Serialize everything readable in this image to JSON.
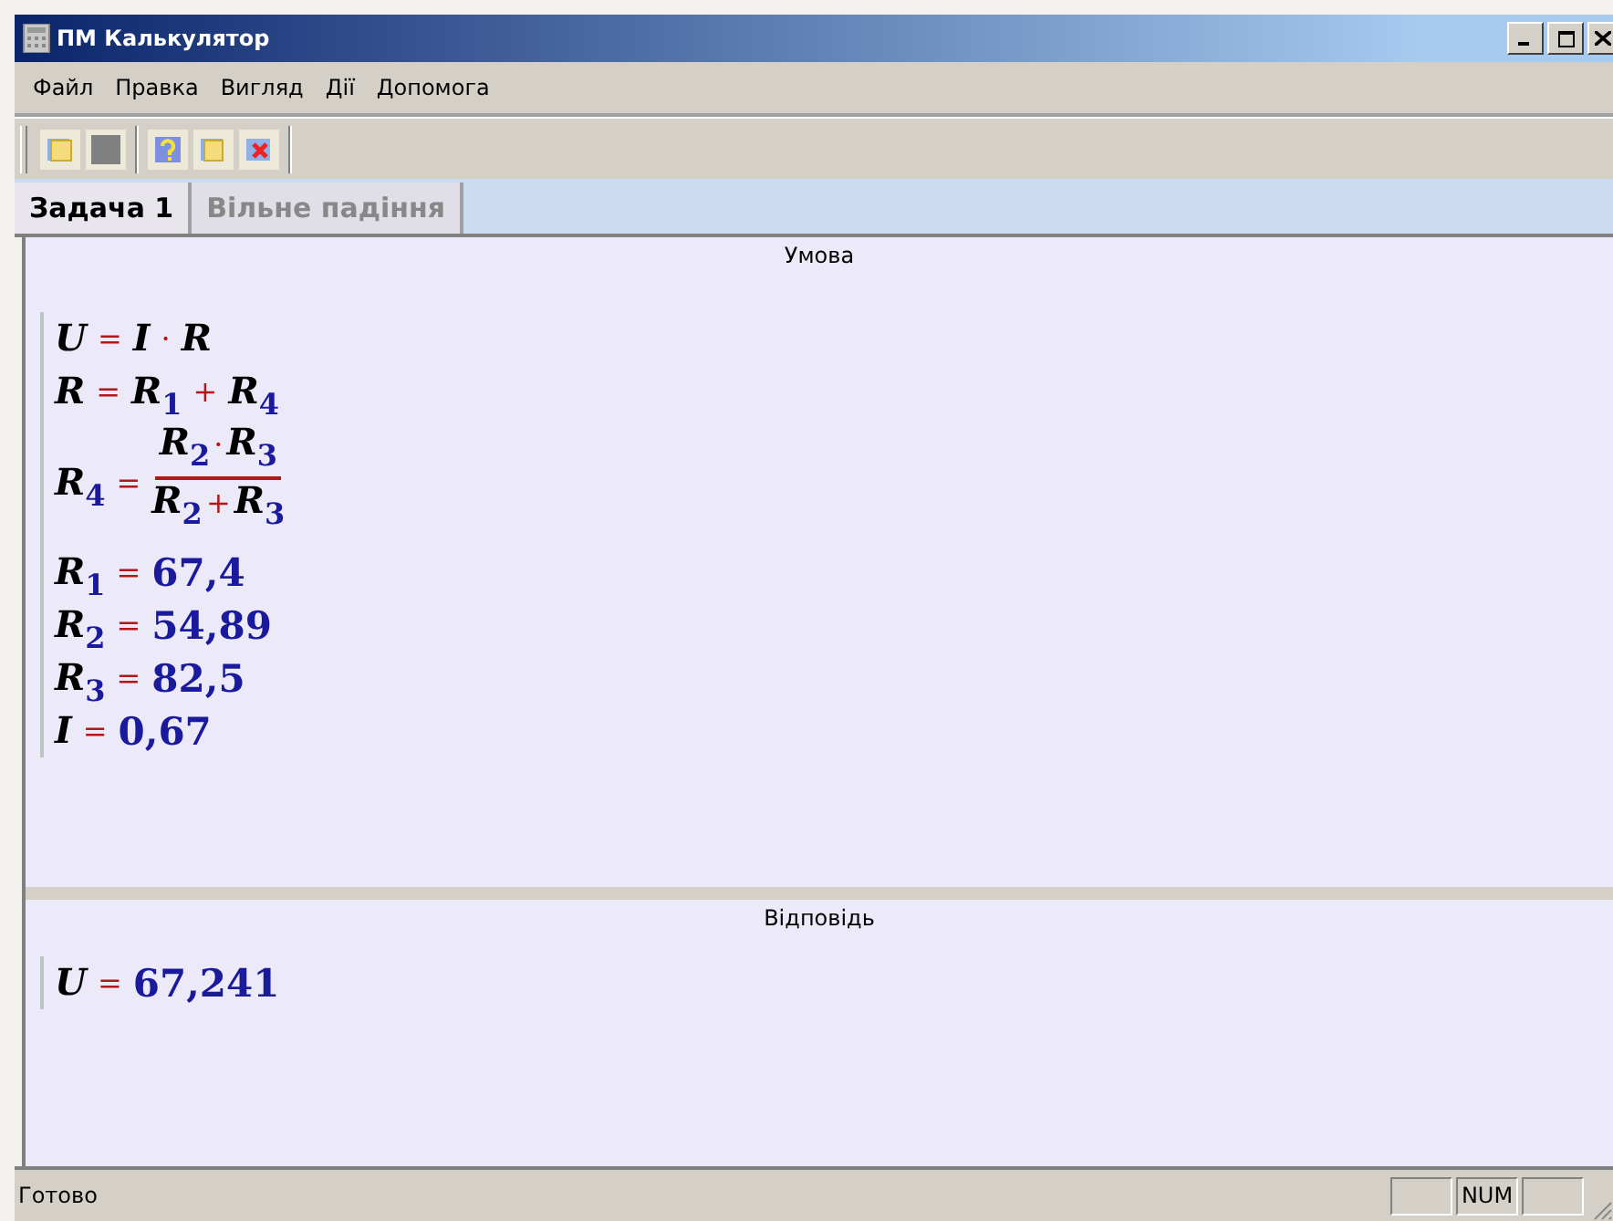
{
  "window": {
    "title": "ПМ Калькулятор"
  },
  "menu": [
    "Файл",
    "Правка",
    "Вигляд",
    "Дії",
    "Допомога"
  ],
  "toolbar": [
    {
      "kind": "open"
    },
    {
      "kind": "blank"
    },
    {
      "kind": "sep"
    },
    {
      "kind": "help"
    },
    {
      "kind": "note"
    },
    {
      "kind": "delete"
    }
  ],
  "tabs": [
    {
      "label": "Задача 1",
      "selected": true
    },
    {
      "label": "Вільне падіння",
      "selected": false
    }
  ],
  "condition": {
    "title": "Умова",
    "lines": [
      {
        "tokens": [
          {
            "kind": "var",
            "text": "U"
          },
          {
            "kind": "op",
            "text": "="
          },
          {
            "kind": "var",
            "text": "I"
          },
          {
            "kind": "op",
            "text": "·"
          },
          {
            "kind": "var",
            "text": "R"
          }
        ]
      },
      {
        "tokens": [
          {
            "kind": "var",
            "text": "R"
          },
          {
            "kind": "op",
            "text": "="
          },
          {
            "kind": "var",
            "text": "R",
            "sub": "1"
          },
          {
            "kind": "op",
            "text": "+"
          },
          {
            "kind": "var",
            "text": "R",
            "sub": "4"
          }
        ]
      },
      {
        "tokens": [
          {
            "kind": "var",
            "text": "R",
            "sub": "4"
          },
          {
            "kind": "op",
            "text": "="
          },
          {
            "kind": "frac",
            "num": [
              {
                "kind": "var",
                "text": "R",
                "sub": "2"
              },
              {
                "kind": "op",
                "text": "·"
              },
              {
                "kind": "var",
                "text": "R",
                "sub": "3"
              }
            ],
            "den": [
              {
                "kind": "var",
                "text": "R",
                "sub": "2"
              },
              {
                "kind": "op",
                "text": "+"
              },
              {
                "kind": "var",
                "text": "R",
                "sub": "3"
              }
            ]
          }
        ]
      },
      {
        "tokens": [
          {
            "kind": "var",
            "text": "R",
            "sub": "1"
          },
          {
            "kind": "op",
            "text": "="
          },
          {
            "kind": "num",
            "text": "67,4"
          }
        ]
      },
      {
        "tokens": [
          {
            "kind": "var",
            "text": "R",
            "sub": "2"
          },
          {
            "kind": "op",
            "text": "="
          },
          {
            "kind": "num",
            "text": "54,89"
          }
        ]
      },
      {
        "tokens": [
          {
            "kind": "var",
            "text": "R",
            "sub": "3"
          },
          {
            "kind": "op",
            "text": "="
          },
          {
            "kind": "num",
            "text": "82,5"
          }
        ]
      },
      {
        "tokens": [
          {
            "kind": "var",
            "text": "I"
          },
          {
            "kind": "op",
            "text": "="
          },
          {
            "kind": "num",
            "text": "0,67"
          }
        ]
      }
    ]
  },
  "answer": {
    "title": "Відповідь",
    "lines": [
      {
        "tokens": [
          {
            "kind": "var",
            "text": "U"
          },
          {
            "kind": "op",
            "text": "="
          },
          {
            "kind": "num",
            "text": "67,241"
          }
        ]
      }
    ]
  },
  "status_bar": {
    "text": "Готово",
    "panes": [
      {
        "kind": "blank"
      },
      {
        "kind": "text",
        "text": "NUM"
      },
      {
        "kind": "blank"
      }
    ]
  }
}
